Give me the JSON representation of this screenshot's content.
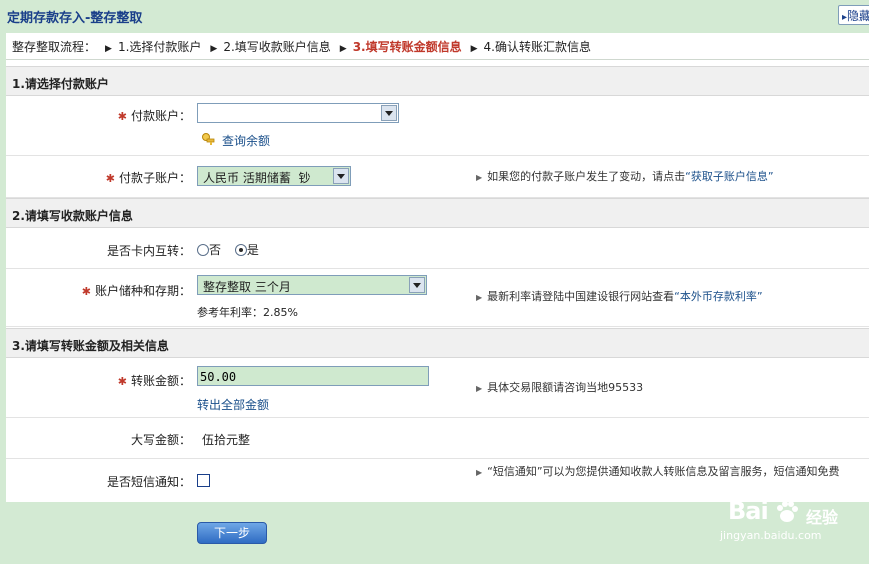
{
  "page": {
    "title": "定期存款存入-整存整取",
    "hide_label": "隐藏"
  },
  "steps": {
    "prefix": "整存整取流程：",
    "items": [
      "1.选择付款账户",
      "2.填写收款账户信息",
      "3.填写转账金额信息",
      "4.确认转账汇款信息"
    ],
    "active_index": 2
  },
  "section1": {
    "title": "1.请选择付款账户",
    "payer_account_label": "付款账户：",
    "payer_account_value": "",
    "query_balance_link": "查询余额",
    "sub_account_label": "付款子账户：",
    "sub_account_value": "人民币 活期储蓄  钞",
    "sub_account_hint_pre": "如果您的付款子账户发生了变动，请点击",
    "sub_account_hint_link": "“获取子账户信息”"
  },
  "section2": {
    "title": "2.请填写收款账户信息",
    "intra_card_label": "是否卡内互转：",
    "option_no": "否",
    "option_yes": "是",
    "selected": "yes",
    "deposit_type_label": "账户储种和存期：",
    "deposit_type_value": "整存整取 三个月",
    "rate_note": "参考年利率：2.85%",
    "rate_hint_pre": "最新利率请登陆中国建设银行网站查看",
    "rate_hint_link": "“本外币存款利率”"
  },
  "section3": {
    "title": "3.请填写转账金额及相关信息",
    "amount_label": "转账金额：",
    "amount_value": "50.00",
    "transfer_all_link": "转出全部金额",
    "amount_hint": "具体交易限额请咨询当地95533",
    "uppercase_label": "大写金额：",
    "uppercase_value": "伍拾元整",
    "sms_label": "是否短信通知：",
    "sms_checked": false,
    "sms_hint": "“短信通知”可以为您提供通知收款人转账信息及留言服务，短信通知免费"
  },
  "actions": {
    "next_label": "下一步"
  },
  "watermark": {
    "brand": "Bai",
    "brand_suffix": "经验",
    "url": "jingyan.baidu.com"
  },
  "colors": {
    "page_bg": "#d3ead3",
    "title": "#1a3f8a",
    "active_step": "#c0392b",
    "link": "#1a4f8a",
    "input_bg": "#cfe9cf"
  }
}
